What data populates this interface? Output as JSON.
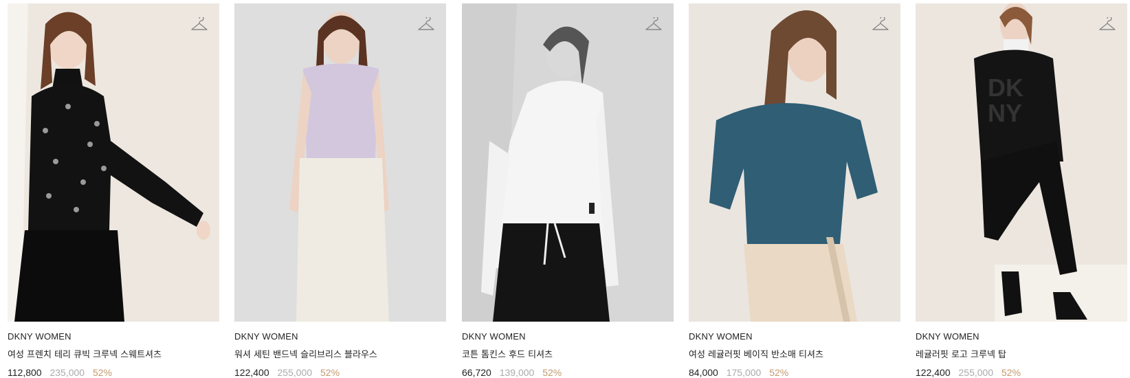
{
  "products": [
    {
      "brand": "DKNY WOMEN",
      "name": "여성 프렌치 테리 큐빅 크루넥 스웨트셔츠",
      "price": "112,800",
      "original_price": "235,000",
      "discount": "52%"
    },
    {
      "brand": "DKNY WOMEN",
      "name": "워셔 세틴 밴드넥 슬리브리스 블라우스",
      "price": "122,400",
      "original_price": "255,000",
      "discount": "52%"
    },
    {
      "brand": "DKNY WOMEN",
      "name": "코튼 톰킨스 후드 티셔츠",
      "price": "66,720",
      "original_price": "139,000",
      "discount": "52%"
    },
    {
      "brand": "DKNY WOMEN",
      "name": "여성 레귤러핏 베이직 반소매 티셔츠",
      "price": "84,000",
      "original_price": "175,000",
      "discount": "52%"
    },
    {
      "brand": "DKNY WOMEN",
      "name": "레귤러핏 로고 크루넥 탑",
      "price": "122,400",
      "original_price": "255,000",
      "discount": "52%"
    }
  ],
  "icons": {
    "wishlist": "hanger-icon"
  },
  "colors": {
    "discount": "#c49a6c",
    "original_price": "#aaaaaa",
    "text": "#222222"
  }
}
